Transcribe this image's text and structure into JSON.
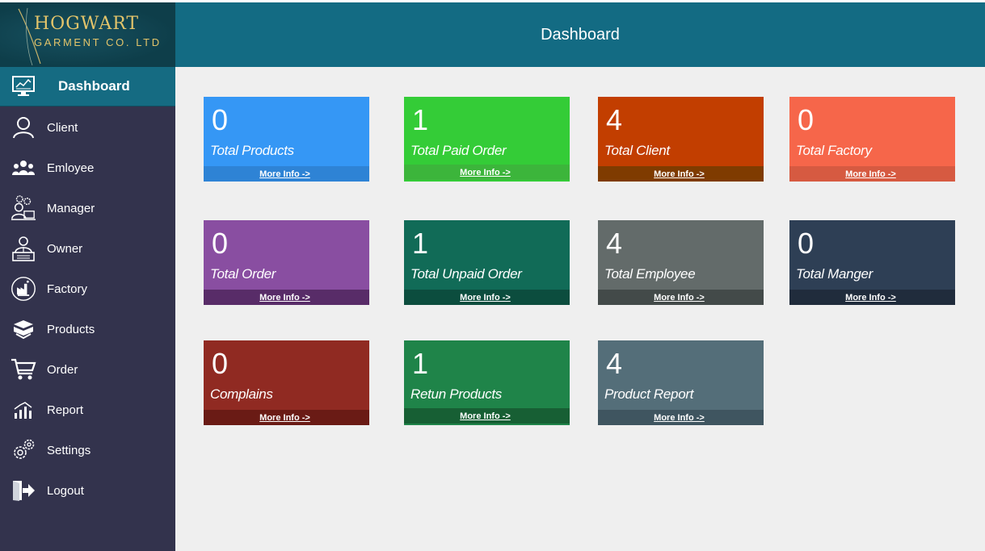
{
  "brand": {
    "line1": "HOGWART",
    "line2": "GARMENT CO. LTD"
  },
  "header": {
    "title": "Dashboard"
  },
  "sidebar": {
    "items": [
      {
        "label": "Dashboard",
        "icon": "dashboard-monitor-icon",
        "active": true
      },
      {
        "label": "Client",
        "icon": "user-icon"
      },
      {
        "label": "Emloyee",
        "icon": "group-icon"
      },
      {
        "label": "Manager",
        "icon": "manager-gear-icon"
      },
      {
        "label": "Owner",
        "icon": "owner-desk-icon"
      },
      {
        "label": "Factory",
        "icon": "factory-icon"
      },
      {
        "label": "Products",
        "icon": "box-icon"
      },
      {
        "label": "Order",
        "icon": "cart-icon"
      },
      {
        "label": "Report",
        "icon": "report-chart-icon"
      },
      {
        "label": "Settings",
        "icon": "gear-icon"
      },
      {
        "label": "Logout",
        "icon": "logout-icon"
      }
    ]
  },
  "cards": [
    {
      "value": "0",
      "label": "Total Products",
      "more": "More Info ->",
      "color": "#3597f5",
      "footer": "#2e83d5"
    },
    {
      "value": "1",
      "label": "Total Paid Order",
      "more": "More Info ->",
      "color": "#34cc37",
      "footer": "#3cb53b"
    },
    {
      "value": "4",
      "label": "Total Client",
      "more": "More Info ->",
      "color": "#c23e00",
      "footer": "#7f3b00"
    },
    {
      "value": "0",
      "label": "Total Factory",
      "more": "More Info ->",
      "color": "#f6664a",
      "footer": "#d65a41"
    },
    {
      "value": "0",
      "label": "Total Order",
      "more": "More Info ->",
      "color": "#894ea1",
      "footer": "#582c68"
    },
    {
      "value": "1",
      "label": "Total Unpaid Order",
      "more": "More Info ->",
      "color": "#116b57",
      "footer": "#0c4d3e"
    },
    {
      "value": "4",
      "label": "Total Employee",
      "more": "More Info ->",
      "color": "#636b6a",
      "footer": "#434a49"
    },
    {
      "value": "0",
      "label": "Total Manger",
      "more": "More Info ->",
      "color": "#2e3f55",
      "footer": "#202c3c"
    },
    {
      "value": "0",
      "label": "Complains",
      "more": "More Info ->",
      "color": "#902a22",
      "footer": "#6a1b15"
    },
    {
      "value": "1",
      "label": "Retun Products",
      "more": "More Info ->",
      "color": "#1f8449",
      "footer": "#175f34"
    },
    {
      "value": "4",
      "label": "Product Report",
      "more": "More Info ->",
      "color": "#546e79",
      "footer": "#3f5560"
    }
  ]
}
